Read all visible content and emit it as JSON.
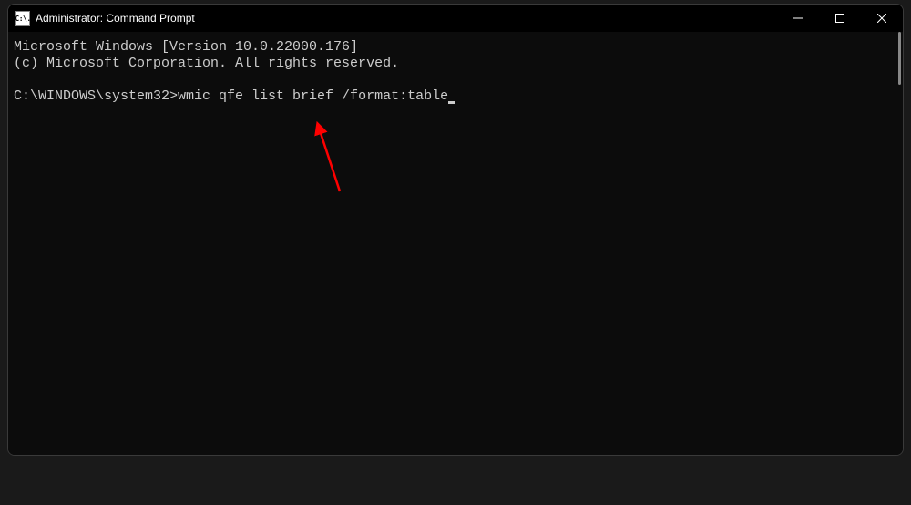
{
  "window": {
    "title": "Administrator: Command Prompt",
    "icon_glyph": "C:\\."
  },
  "terminal": {
    "header_line1": "Microsoft Windows [Version 10.0.22000.176]",
    "header_line2": "(c) Microsoft Corporation. All rights reserved.",
    "prompt": "C:\\WINDOWS\\system32>",
    "command": "wmic qfe list brief /format:table"
  },
  "annotation": {
    "color": "#ff0000"
  }
}
